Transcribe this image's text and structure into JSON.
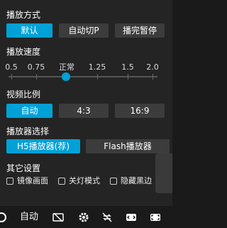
{
  "play_mode": {
    "title": "播放方式",
    "options": [
      "默认",
      "自动切P",
      "播完暂停"
    ],
    "selected": 0
  },
  "speed": {
    "title": "播放速度",
    "labels": [
      "0.5",
      "0.75",
      "正常",
      "1.25",
      "1.5",
      "2.0"
    ],
    "selected": "正常"
  },
  "ratio": {
    "title": "视频比例",
    "options": [
      "自动",
      "4:3",
      "16:9"
    ],
    "selected": 0
  },
  "player": {
    "title": "播放器选择",
    "options": [
      "H5播放器(荐)",
      "Flash播放器"
    ],
    "selected": 0
  },
  "other": {
    "title": "其它设置",
    "checkboxes": [
      "镜像画面",
      "关灯模式",
      "隐藏黑边"
    ]
  },
  "control_bar": {
    "quality": "自动"
  },
  "colors": {
    "accent": "#00a1d6"
  }
}
